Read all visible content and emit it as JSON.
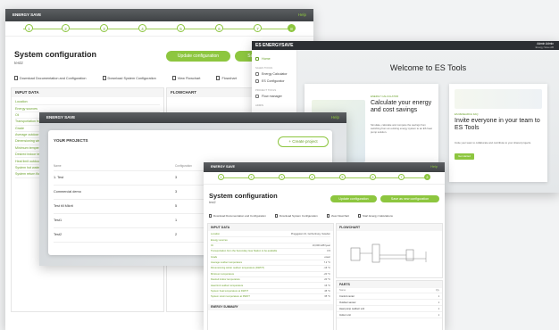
{
  "config_back": {
    "header": "ENERGY SAVE",
    "help": "Help",
    "steps": [
      "1",
      "2",
      "3",
      "4",
      "5",
      "6",
      "7",
      "8"
    ],
    "title": "System configuration",
    "subtitle": "test2",
    "update_btn": "Update configuration",
    "save_btn": "Save",
    "links": [
      "Download Documentation and Configuration",
      "Download System Configuration",
      "View Flowchart",
      "Flowchart"
    ],
    "input_data": "INPUT DATA",
    "flowchart": "FLOWCHART",
    "rows": [
      {
        "label": "Location",
        "value": ""
      },
      {
        "label": "Energy sources",
        "value": ""
      },
      {
        "label": "Oil",
        "value": ""
      },
      {
        "label": "Transportation from the Secondary Gas Station to be available",
        "value": ""
      },
      {
        "label": "Grade",
        "value": ""
      },
      {
        "label": "Average outdoor temperature",
        "value": ""
      },
      {
        "label": "Dimensioning winter outdoor temperature",
        "value": ""
      },
      {
        "label": "Minimum temperature",
        "value": ""
      },
      {
        "label": "Desired indoor temperature",
        "value": ""
      },
      {
        "label": "Heat limit outdoor temperature",
        "value": ""
      },
      {
        "label": "System hot water",
        "value": ""
      },
      {
        "label": "System return flow",
        "value": ""
      }
    ],
    "energy_summary": "ENERGY SUMMARY"
  },
  "es_tools": {
    "logo": "ES ENERGYSAVE",
    "user_name": "Admin Admin",
    "user_company": "Energy Save AB",
    "nav": [
      {
        "label": "Home",
        "icon": "home-icon"
      },
      {
        "label": "Energy Calculator",
        "icon": "calculator-icon"
      },
      {
        "label": "ES Configurator",
        "icon": "configurator-icon"
      },
      {
        "label": "Flow manager",
        "icon": "flow-icon"
      }
    ],
    "section_labels": [
      "SALES TOOLS",
      "PROJECT TOOLS",
      "ADMIN"
    ],
    "welcome": "Welcome to ES Tools",
    "calc_tag": "ENERGY CALCULATOR",
    "calc_title": "Calculate your energy and cost savings",
    "calc_text": "Simulate, calculate and compare the savings from switching from an existing energy system to an ES heat pump solution.",
    "invite_tag": "ES RESEARCH FAQ",
    "invite_title": "Invite everyone in your team to ES Tools",
    "invite_text": "Invite your team to collaborate and contribute to your shared projects.",
    "invite_btn": "Get started"
  },
  "projects": {
    "header": "ENERGY SAVE",
    "help": "Help",
    "title": "YOUR PROJECTS",
    "create_btn": "+ Create project",
    "col_name": "Name",
    "col_configs": "Configuration",
    "rows": [
      {
        "name": "1. Test",
        "configs": "3"
      },
      {
        "name": "Commercial demo",
        "configs": "3"
      },
      {
        "name": "Test till Mikrit",
        "configs": "5"
      },
      {
        "name": "Test1",
        "configs": "1"
      },
      {
        "name": "Test2",
        "configs": "2"
      }
    ]
  },
  "config_front": {
    "header": "ENERGY SAVE",
    "help": "Help",
    "steps": [
      "1",
      "2",
      "3",
      "4",
      "5",
      "6",
      "7",
      "8"
    ],
    "title": "System configuration",
    "subtitle": "test2",
    "update_btn": "Update configuration",
    "save_new_btn": "Save as new configuration",
    "links": [
      "Download Documentation and Configuration",
      "Download System Configuration",
      "View Flowchart",
      "Start Energy Calculations"
    ],
    "input_data": "INPUT DATA",
    "flowchart": "FLOWCHART",
    "parts": "PARTS",
    "parts_col_name": "Name",
    "parts_col_qty": "Qty",
    "parts_rows": [
      {
        "name": "Control center",
        "qty": "1"
      },
      {
        "name": "Outdoor sensor",
        "qty": "1"
      },
      {
        "name": "Heat pump outdoor unit",
        "qty": "1"
      },
      {
        "name": "Indoor unit",
        "qty": "1"
      }
    ],
    "rows": [
      {
        "label": "Location",
        "value": "Pingggatan 10, Gothenburg, Sweden"
      },
      {
        "label": "Energy sources",
        "value": ""
      },
      {
        "label": "Oil",
        "value": "10,000 kWh/year"
      },
      {
        "label": "Transportation from the Secondary Gas Station to be available",
        "value": "0.5"
      },
      {
        "label": "Grade",
        "value": "Lower"
      },
      {
        "label": "Average outdoor temperature",
        "value": "7.2 °C"
      },
      {
        "label": "Dimensioning winter outdoor temperature (DWOT)",
        "value": "-16 °C"
      },
      {
        "label": "Minimum temperature",
        "value": "-20 °C"
      },
      {
        "label": "Desired indoor temperature",
        "value": "20 °C"
      },
      {
        "label": "Heat limit outdoor temperature",
        "value": "16 °C"
      },
      {
        "label": "System heat temperature at DWOT",
        "value": "45 °C"
      },
      {
        "label": "System return temperature at DWOT",
        "value": "35 °C"
      }
    ],
    "energy_summary": "ENERGY SUMMARY"
  }
}
